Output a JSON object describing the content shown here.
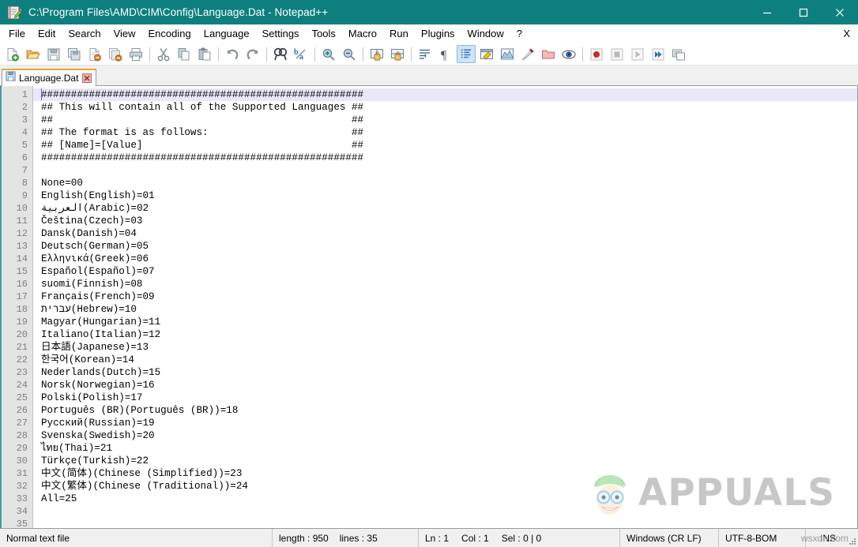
{
  "window": {
    "title": "C:\\Program Files\\AMD\\CIM\\Config\\Language.Dat - Notepad++",
    "app_icon": "notepad-plus-plus-icon",
    "minimize_label": "Minimize",
    "maximize_label": "Maximize",
    "close_label": "Close",
    "titlebar_color": "#0e7f7f"
  },
  "menubar": {
    "items": [
      {
        "label": "File",
        "name": "menu-file"
      },
      {
        "label": "Edit",
        "name": "menu-edit"
      },
      {
        "label": "Search",
        "name": "menu-search"
      },
      {
        "label": "View",
        "name": "menu-view"
      },
      {
        "label": "Encoding",
        "name": "menu-encoding"
      },
      {
        "label": "Language",
        "name": "menu-language"
      },
      {
        "label": "Settings",
        "name": "menu-settings"
      },
      {
        "label": "Tools",
        "name": "menu-tools"
      },
      {
        "label": "Macro",
        "name": "menu-macro"
      },
      {
        "label": "Run",
        "name": "menu-run"
      },
      {
        "label": "Plugins",
        "name": "menu-plugins"
      },
      {
        "label": "Window",
        "name": "menu-window"
      },
      {
        "label": "?",
        "name": "menu-help"
      }
    ],
    "right_label": "X"
  },
  "toolbar": {
    "buttons": [
      {
        "name": "new-file-icon",
        "title": "New"
      },
      {
        "name": "open-file-icon",
        "title": "Open"
      },
      {
        "name": "save-icon",
        "title": "Save"
      },
      {
        "name": "save-all-icon",
        "title": "Save All"
      },
      {
        "name": "close-document-icon",
        "title": "Close"
      },
      {
        "name": "close-all-documents-icon",
        "title": "Close All"
      },
      {
        "name": "print-icon",
        "title": "Print"
      },
      {
        "name": "separator-1",
        "title": ""
      },
      {
        "name": "cut-icon",
        "title": "Cut"
      },
      {
        "name": "copy-icon",
        "title": "Copy"
      },
      {
        "name": "paste-icon",
        "title": "Paste"
      },
      {
        "name": "separator-2",
        "title": ""
      },
      {
        "name": "undo-icon",
        "title": "Undo"
      },
      {
        "name": "redo-icon",
        "title": "Redo"
      },
      {
        "name": "separator-3",
        "title": ""
      },
      {
        "name": "find-icon",
        "title": "Find"
      },
      {
        "name": "replace-icon",
        "title": "Replace"
      },
      {
        "name": "separator-4",
        "title": ""
      },
      {
        "name": "zoom-in-icon",
        "title": "Zoom In"
      },
      {
        "name": "zoom-out-icon",
        "title": "Zoom Out"
      },
      {
        "name": "separator-5",
        "title": ""
      },
      {
        "name": "sync-vertical-scroll-icon",
        "title": "Synchronize Vertical Scrolling"
      },
      {
        "name": "sync-horizontal-scroll-icon",
        "title": "Synchronize Horizontal Scrolling"
      },
      {
        "name": "separator-6",
        "title": ""
      },
      {
        "name": "word-wrap-icon",
        "title": "Word wrap"
      },
      {
        "name": "show-all-characters-icon",
        "title": "Show All Characters"
      },
      {
        "name": "show-indent-guide-icon",
        "title": "Show Indent Guide"
      },
      {
        "name": "ui-user-defined-dialog-icon",
        "title": "User-Defined Dialogue"
      },
      {
        "name": "document-map-icon",
        "title": "Document Map"
      },
      {
        "name": "function-list-icon",
        "title": "Function List"
      },
      {
        "name": "folder-as-workspace-icon",
        "title": "Folder as Workspace"
      },
      {
        "name": "monitoring-icon",
        "title": "Monitoring"
      },
      {
        "name": "separator-7",
        "title": ""
      },
      {
        "name": "record-macro-icon",
        "title": "Start Recording"
      },
      {
        "name": "stop-macro-icon",
        "title": "Stop Recording"
      },
      {
        "name": "play-macro-icon",
        "title": "Playback"
      },
      {
        "name": "run-macro-multiple-icon",
        "title": "Run a Macro Multiple Times"
      },
      {
        "name": "save-macro-icon",
        "title": "Save Current Recorded Macro"
      }
    ]
  },
  "tabs": [
    {
      "label": "Language.Dat",
      "icon": "saved-file-icon",
      "close_icon": "close-tab-icon",
      "active": true
    }
  ],
  "editor": {
    "first_line_number": 1,
    "caret_line_index": 0,
    "lines": [
      "######################################################",
      "## This will contain all of the Supported Languages ##",
      "##                                                  ##",
      "## The format is as follows:                        ##",
      "## [Name]=[Value]                                   ##",
      "######################################################",
      "",
      "None=00",
      "English(English)=01",
      "العربية(Arabic)=02",
      "Čeština(Czech)=03",
      "Dansk(Danish)=04",
      "Deutsch(German)=05",
      "Ελληνικά(Greek)=06",
      "Español(Español)=07",
      "suomi(Finnish)=08",
      "Français(French)=09",
      "עברית(Hebrew)=10",
      "Magyar(Hungarian)=11",
      "Italiano(Italian)=12",
      "日本語(Japanese)=13",
      "한국어(Korean)=14",
      "Nederlands(Dutch)=15",
      "Norsk(Norwegian)=16",
      "Polski(Polish)=17",
      "Português (BR)(Português (BR))=18",
      "Русский(Russian)=19",
      "Svenska(Swedish)=20",
      "ไทย(Thai)=21",
      "Türkçe(Turkish)=22",
      "中文(简体)(Chinese (Simplified))=23",
      "中文(繁体)(Chinese (Traditional))=24",
      "All=25",
      "",
      ""
    ]
  },
  "watermark": {
    "logo_text": "APPUALS",
    "status_text": "wsxdn.com"
  },
  "statusbar": {
    "file_type": "Normal text file",
    "length_label": "length : 950",
    "lines_label": "lines : 35",
    "ln": "Ln : 1",
    "col": "Col : 1",
    "sel": "Sel : 0 | 0",
    "eol": "Windows (CR LF)",
    "encoding": "UTF-8-BOM",
    "insert_mode": "INS"
  }
}
